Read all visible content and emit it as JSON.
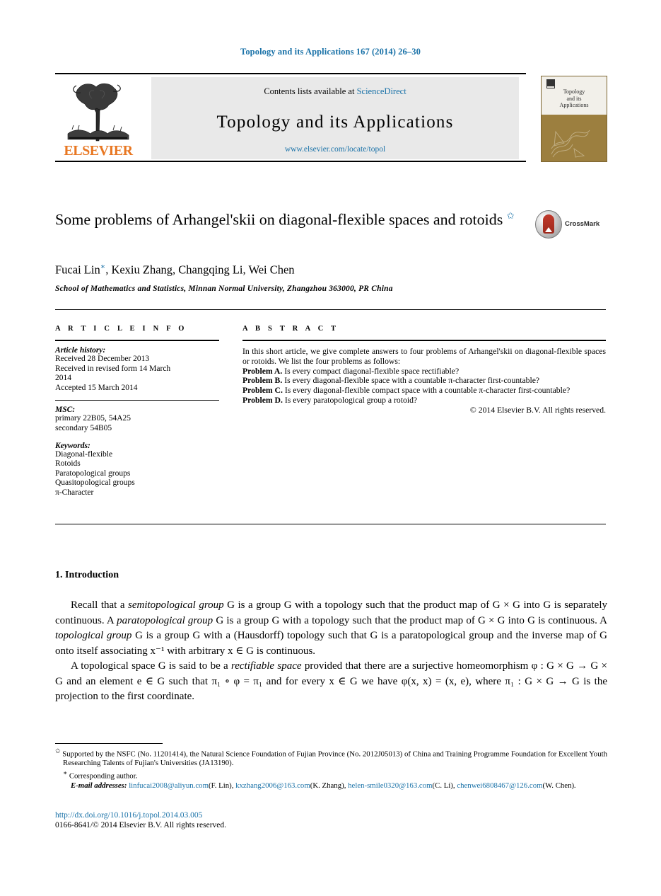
{
  "running_head": "Topology and its Applications 167 (2014) 26–30",
  "masthead": {
    "publisher_wordmark": "ELSEVIER",
    "contents_prefix": "Contents lists available at ",
    "contents_link": "ScienceDirect",
    "journal_title": "Topology and its Applications",
    "journal_url": "www.elsevier.com/locate/topol",
    "cover_title_line1": "Topology",
    "cover_title_line2": "and its",
    "cover_title_line3": "Applications"
  },
  "article": {
    "title": "Some problems of Arhangel'skii on diagonal-flexible spaces and rotoids",
    "title_footnote_mark": "✩",
    "authors": "Fucai Lin",
    "authors_rest": ", Kexiu Zhang, Changqing Li, Wei Chen",
    "author_corresponding_mark": "∗",
    "affiliation": "School of Mathematics and Statistics, Minnan Normal University, Zhangzhou 363000, PR China"
  },
  "crossmark": {
    "label": "CrossMark"
  },
  "info": {
    "heading": "A R T I C L E   I N F O",
    "history_label": "Article history:",
    "history_lines": [
      "Received 28 December 2013",
      "Received in revised form 14 March",
      "2014",
      "Accepted 15 March 2014"
    ],
    "msc_label": "MSC:",
    "msc_lines": [
      "primary 22B05, 54A25",
      "secondary 54B05"
    ],
    "keywords_label": "Keywords:",
    "keywords": [
      "Diagonal-flexible",
      "Rotoids",
      "Paratopological groups",
      "Quasitopological groups",
      "π-Character"
    ]
  },
  "abstract": {
    "heading": "A B S T R A C T",
    "intro": "In this short article, we give complete answers to four problems of Arhangel'skii on diagonal-flexible spaces or rotoids. We list the four problems as follows:",
    "problems": [
      {
        "label": "Problem A.",
        "text": "Is every compact diagonal-flexible space rectifiable?"
      },
      {
        "label": "Problem B.",
        "text": "Is every diagonal-flexible space with a countable π-character first-countable?"
      },
      {
        "label": "Problem C.",
        "text": "Is every diagonal-flexible compact space with a countable π-character first-countable?"
      },
      {
        "label": "Problem D.",
        "text": "Is every paratopological group a rotoid?"
      }
    ],
    "copyright": "© 2014 Elsevier B.V. All rights reserved."
  },
  "body": {
    "section_heading": "1. Introduction",
    "paragraph1_parts": {
      "p1a": "Recall that a ",
      "p1b": "semitopological group",
      "p1c": " G is a group G with a topology such that the product map of G × G into G is separately continuous. A ",
      "p1d": "paratopological group",
      "p1e": " G is a group G with a topology such that the product map of G × G into G is continuous. A ",
      "p1f": "topological group",
      "p1g": " G is a group G with a (Hausdorff) topology such that G is a paratopological group and the inverse map of G onto itself associating x⁻¹ with arbitrary x ∈ G is continuous."
    },
    "paragraph2_parts": {
      "p2a": "A topological space G is said to be a ",
      "p2b": "rectifiable space",
      "p2c": " provided that there are a surjective homeomorphism φ : G × G → G × G and an element e ∈ G such that π₁ ∘ φ = π₁ and for every x ∈ G we have φ(x, x) = (x, e), where π₁ : G × G → G is the projection to the first coordinate."
    }
  },
  "footnotes": {
    "funding_mark": "✩",
    "funding": "Supported by the NSFC (No. 11201414), the Natural Science Foundation of Fujian Province (No. 2012J05013) of China and Training Programme Foundation for Excellent Youth Researching Talents of Fujian's Universities (JA13190).",
    "corresponding_mark": "∗",
    "corresponding": "Corresponding author.",
    "email_label": "E-mail addresses:",
    "emails": [
      {
        "address": "linfucai2008@aliyun.com",
        "person": "(F. Lin)"
      },
      {
        "address": "kxzhang2006@163.com",
        "person": "(K. Zhang)"
      },
      {
        "address": "helen-smile0320@163.com",
        "person": "(C. Li)"
      },
      {
        "address": "chenwei6808467@126.com",
        "person": "(W. Chen)"
      }
    ]
  },
  "doi": {
    "url": "http://dx.doi.org/10.1016/j.topol.2014.03.005",
    "issn_line": "0166-8641/© 2014 Elsevier B.V. All rights reserved."
  },
  "colors": {
    "link": "#1a72a8",
    "elsevier_orange": "#e87722",
    "cover_brown": "#9c7f3f",
    "masthead_gray": "#e9e9e9"
  }
}
